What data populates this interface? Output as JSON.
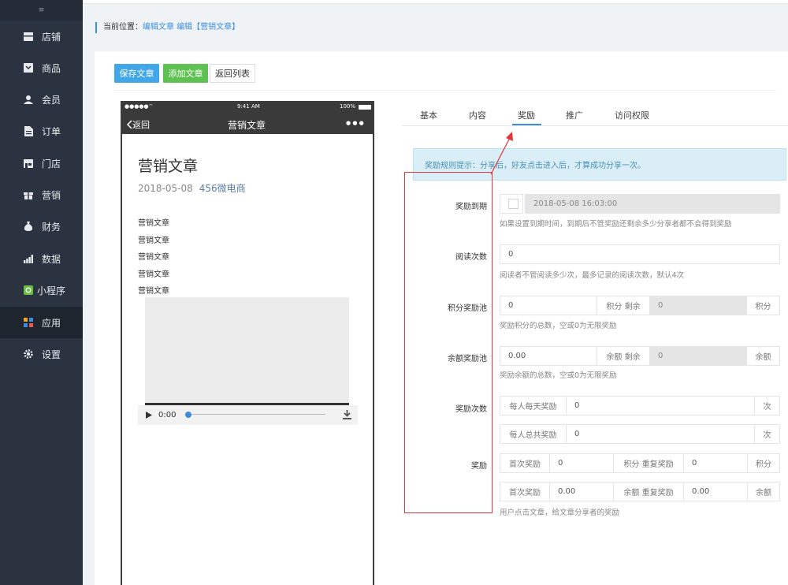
{
  "sidebar": {
    "toggle": "≡",
    "items": [
      {
        "label": "店铺",
        "icon": "store-icon"
      },
      {
        "label": "商品",
        "icon": "goods-icon"
      },
      {
        "label": "会员",
        "icon": "member-icon"
      },
      {
        "label": "订单",
        "icon": "order-icon"
      },
      {
        "label": "门店",
        "icon": "shop-icon"
      },
      {
        "label": "营销",
        "icon": "gift-icon"
      },
      {
        "label": "财务",
        "icon": "money-bag-icon"
      },
      {
        "label": "数据",
        "icon": "chart-icon"
      },
      {
        "label": "小程序",
        "icon": "miniprogram-icon"
      },
      {
        "label": "应用",
        "icon": "apps-icon"
      },
      {
        "label": "设置",
        "icon": "gear-icon"
      }
    ]
  },
  "breadcrumb": {
    "prefix": "当前位置：",
    "link1": "编辑文章",
    "link2": "编辑【营销文章】"
  },
  "toolbar": {
    "save_label": "保存文章",
    "add_label": "添加文章",
    "back_label": "返回列表"
  },
  "phone": {
    "signal": "●●●●● ",
    "time": "9:41 AM",
    "battery": "100%",
    "back": "返回",
    "nav_title": "营销文章",
    "more": "● ● ●",
    "article_title": "营销文章",
    "date": "2018-05-08",
    "shop": "456微电商",
    "lines": [
      "营销文章",
      "营销文章",
      "营销文章",
      "营销文章",
      "营销文章"
    ],
    "audio_time": "0:00"
  },
  "tabs": [
    "基本",
    "内容",
    "奖励",
    "推广",
    "访问权限"
  ],
  "alert": "奖励规则提示：分享后，好友点击进入后，才算成功分享一次。",
  "form": {
    "expire": {
      "label": "奖励到期",
      "value": "2018-05-08 16:03:00",
      "help": "如果设置到期时间，到期后不管奖励还剩余多少分享者都不会得到奖励"
    },
    "reads": {
      "label": "阅读次数",
      "value": "0",
      "help": "阅读者不管阅读多少次，最多记录的阅读次数，默认4次"
    },
    "points_pool": {
      "label": "积分奖励池",
      "value": "0",
      "mid": "积分 剩余",
      "remain": "0",
      "unit": "积分",
      "help": "奖励积分的总数，空或0为无限奖励"
    },
    "balance_pool": {
      "label": "余额奖励池",
      "value": "0.00",
      "mid": "余额 剩余",
      "remain": "0",
      "unit": "余额",
      "help": "奖励余额的总数，空或0为无限奖励"
    },
    "reward_times": {
      "label": "奖励次数",
      "daily_label": "每人每天奖励",
      "daily_value": "0",
      "total_label": "每人总共奖励",
      "total_value": "0",
      "unit": "次"
    },
    "reward": {
      "label": "奖励",
      "first_label": "首次奖励",
      "pts_first": "0",
      "pts_mid": "积分 重复奖励",
      "pts_repeat": "0",
      "pts_unit": "积分",
      "bal_first": "0.00",
      "bal_mid": "余额 重复奖励",
      "bal_repeat": "0.00",
      "bal_unit": "余额",
      "help": "用户点击文章，给文章分享者的奖励"
    }
  },
  "colors": {
    "sidebar": "#2b3340",
    "accent": "#3c8dde",
    "save": "#41a7e8",
    "add": "#5fc152",
    "annotation": "#e3353b"
  }
}
